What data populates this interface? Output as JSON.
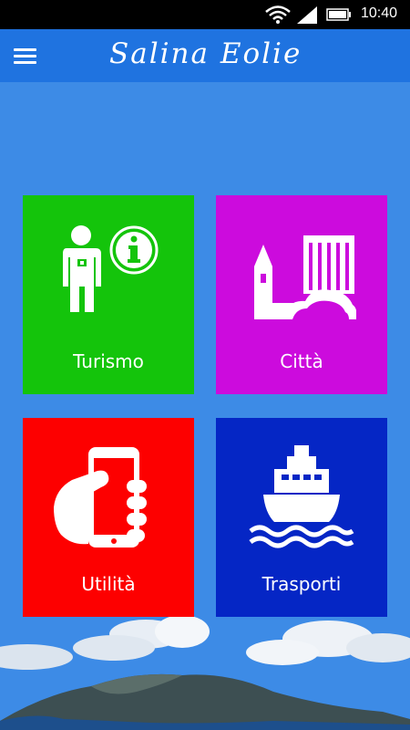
{
  "status_bar": {
    "time": "10:40",
    "icons": [
      "wifi-icon",
      "signal-icon",
      "battery-icon"
    ]
  },
  "app_bar": {
    "title": "Salina Eolie",
    "menu_icon": "hamburger-menu-icon",
    "color": "#1f73e0"
  },
  "tiles": [
    {
      "label": "Turismo",
      "icon": "tourist-info-icon",
      "color": "#14c40b"
    },
    {
      "label": "Città",
      "icon": "city-buildings-icon",
      "color": "#cc0bdd"
    },
    {
      "label": "Utilità",
      "icon": "hand-smartphone-icon",
      "color": "#fd0000"
    },
    {
      "label": "Trasporti",
      "icon": "ship-icon",
      "color": "#0526c5"
    }
  ],
  "background_color": "#3d8be6"
}
